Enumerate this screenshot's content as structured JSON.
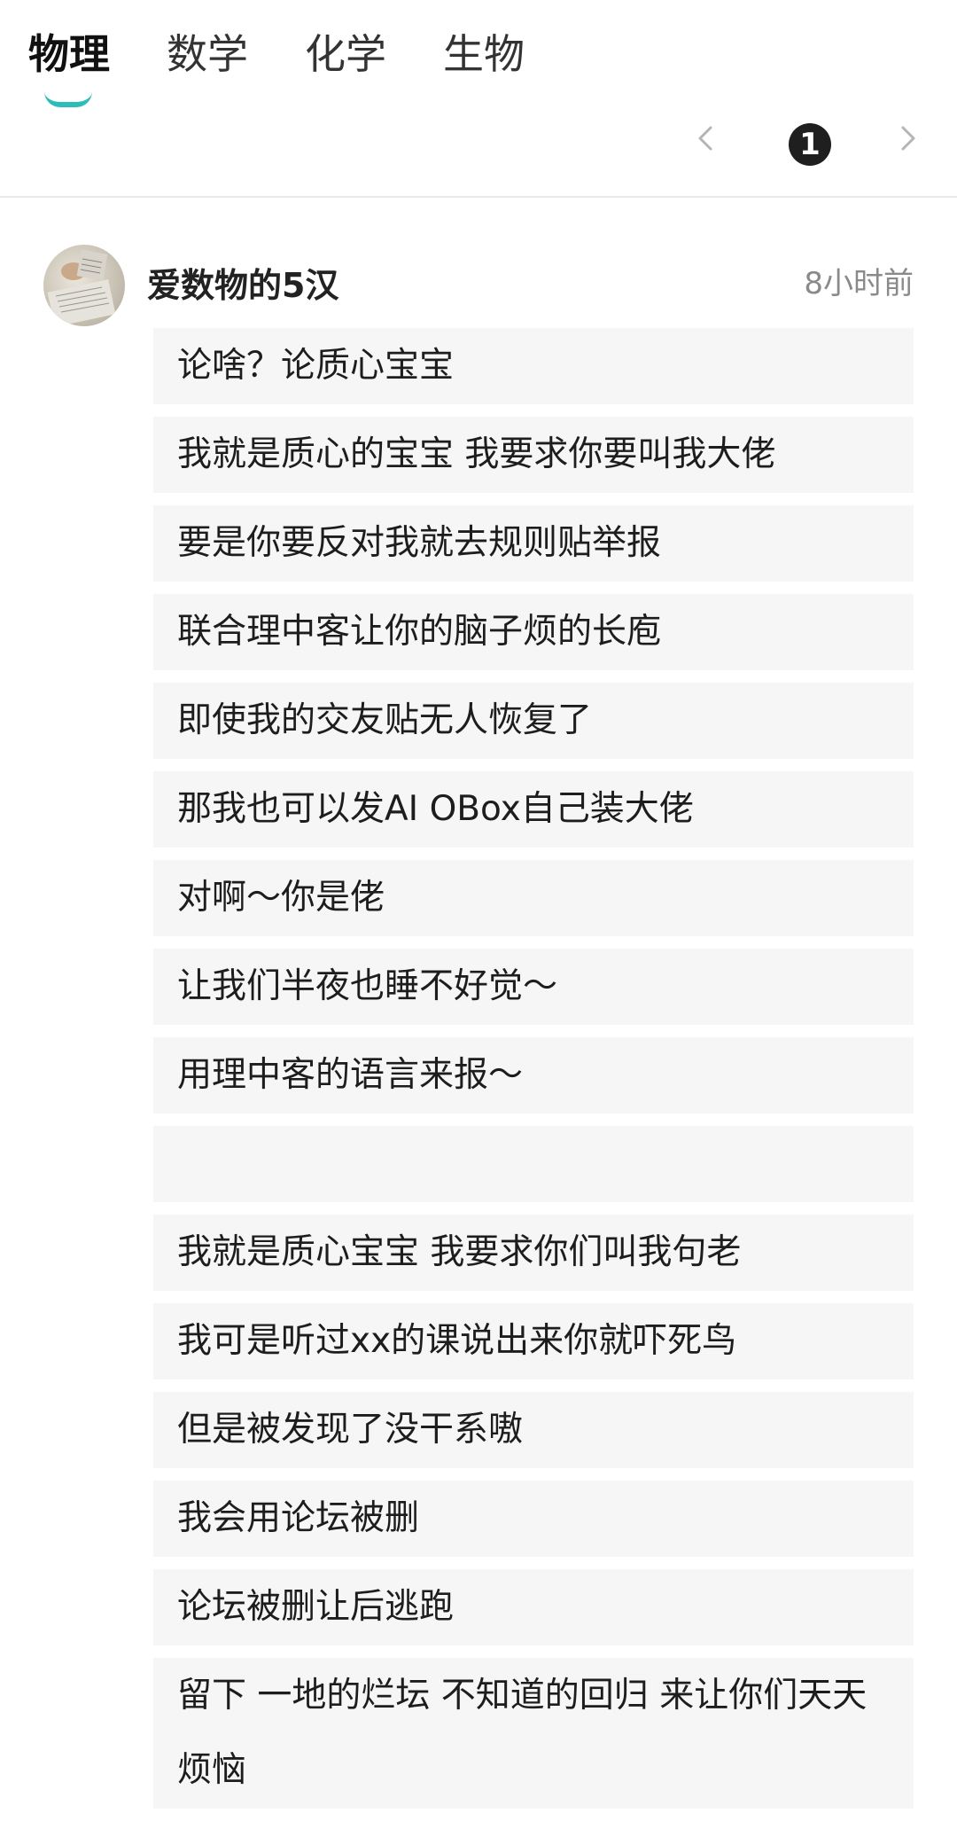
{
  "tabs": [
    {
      "label": "物理",
      "active": true
    },
    {
      "label": "数学",
      "active": false
    },
    {
      "label": "化学",
      "active": false
    },
    {
      "label": "生物",
      "active": false
    }
  ],
  "pagination": {
    "current_page": "1",
    "prev_icon": "chevron-left-icon",
    "next_icon": "chevron-right-icon"
  },
  "colors": {
    "tab_indicator": "#2bbdb9",
    "line_background": "#f6f6f6",
    "page_badge": "#1f1f1f",
    "timestamp": "#8a8a8a"
  },
  "post": {
    "author": "爱数物的5汉",
    "time": "8小时前",
    "lines": [
      "论啥？论质心宝宝",
      "我就是质心的宝宝 我要求你要叫我大佬",
      "要是你要反对我就去规则贴举报",
      "联合理中客让你的脑子烦的长庖",
      "即使我的交友贴无人恢复了",
      "那我也可以发AI OBox自己装大佬",
      "对啊～你是佬",
      "让我们半夜也睡不好觉～",
      "用理中客的语言来报～",
      "",
      "我就是质心宝宝 我要求你们叫我句老",
      "我可是听过xx的课说出来你就吓死鸟",
      "但是被发现了没干系嗷",
      "我会用论坛被删",
      "论坛被删让后逃跑",
      "留下 一地的烂坛 不知道的回归 来让你们天天烦恼"
    ]
  }
}
